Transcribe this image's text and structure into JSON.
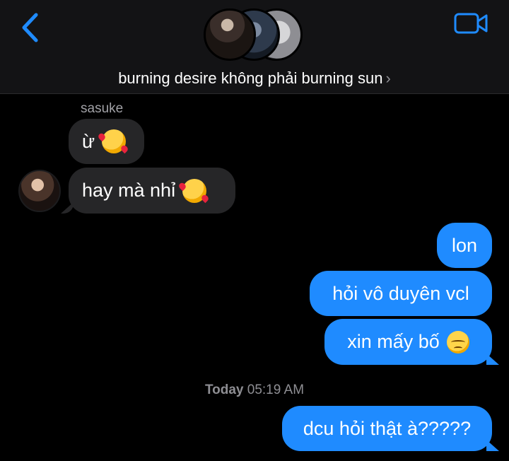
{
  "header": {
    "group_name": "burning desire không phải burning sun",
    "group_chevron": "›",
    "back_icon": "chevron-left-icon",
    "video_icon": "video-camera-icon",
    "accent": "#1f8bff"
  },
  "messages": {
    "incoming_sender": "sasuke",
    "incoming": [
      {
        "text": "ừ",
        "emoji": "smiling-face-with-hearts"
      },
      {
        "text": "hay mà nhỉ",
        "emoji": "smiling-face-with-hearts"
      }
    ],
    "outgoing": [
      {
        "text": "lon"
      },
      {
        "text": "hỏi vô duyên vcl"
      },
      {
        "text": "xin mấy bố",
        "emoji": "pensive-face"
      },
      {
        "text": "dcu hỏi thật à?????"
      }
    ],
    "timestamp_day": "Today",
    "timestamp_time": "05:19 AM"
  },
  "colors": {
    "background": "#000000",
    "incoming_bubble": "#262628",
    "outgoing_bubble": "#1f8bff",
    "secondary_text": "#8e8e93"
  }
}
